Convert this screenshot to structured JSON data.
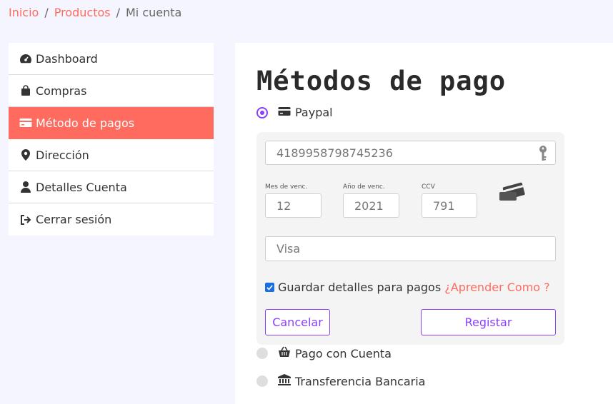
{
  "breadcrumb": {
    "home": "Inicio",
    "products": "Productos",
    "current": "Mi cuenta",
    "separator": "/"
  },
  "sidebar": {
    "items": [
      {
        "label": "Dashboard",
        "icon": "dashboard-icon"
      },
      {
        "label": "Compras",
        "icon": "shopping-bag-icon"
      },
      {
        "label": "Método de pagos",
        "icon": "credit-card-icon",
        "active": true
      },
      {
        "label": "Dirección",
        "icon": "map-marker-icon"
      },
      {
        "label": "Detalles Cuenta",
        "icon": "user-icon"
      },
      {
        "label": "Cerrar sesión",
        "icon": "sign-out-icon"
      }
    ]
  },
  "main": {
    "title": "Métodos de pago",
    "paypal_label": "Paypal",
    "card_form": {
      "card_number": "4189958798745236",
      "exp_month_label": "Mes de venc.",
      "exp_month": "12",
      "exp_year_label": "Año de venc.",
      "exp_year": "2021",
      "ccv_label": "CCV",
      "ccv": "791",
      "card_type_placeholder": "Visa",
      "save_details": "Guardar detalles para pagos",
      "learn_how": "¿Aprender Como ?",
      "cancel": "Cancelar",
      "register": "Registar"
    },
    "account_payment_label": "Pago con Cuenta",
    "bank_transfer_label": "Transferencia Bancaria"
  },
  "colors": {
    "accent": "#ff6b5e",
    "purple": "#8a3ffc"
  }
}
